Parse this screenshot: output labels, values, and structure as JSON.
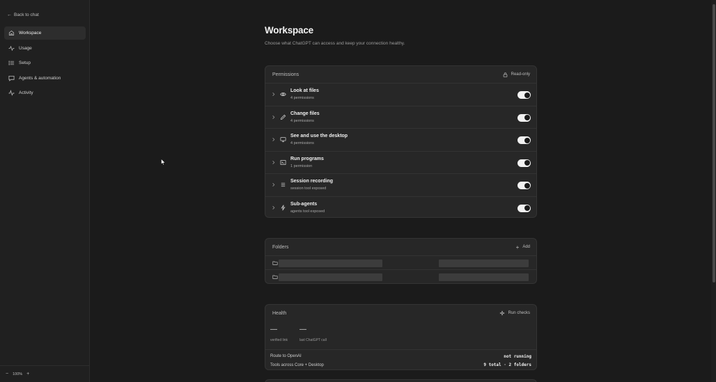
{
  "sidebar": {
    "back_label": "Back to chat",
    "items": [
      {
        "label": "Workspace",
        "icon": "home-icon",
        "active": true
      },
      {
        "label": "Usage",
        "icon": "activity-icon"
      },
      {
        "label": "Setup",
        "icon": "list-icon"
      },
      {
        "label": "Agents & automation",
        "icon": "message-icon"
      },
      {
        "label": "Activity",
        "icon": "pulse-icon"
      }
    ],
    "zoom": {
      "minus": "−",
      "level": "100%",
      "plus": "+"
    }
  },
  "page": {
    "title": "Workspace",
    "subtitle": "Choose what ChatGPT can access and keep your connection healthy."
  },
  "permissions": {
    "title": "Permissions",
    "status": "Read-only",
    "rows": [
      {
        "title": "Look at files",
        "subtitle": "4 permissions",
        "icon": "eye-icon",
        "enabled": true
      },
      {
        "title": "Change files",
        "subtitle": "4 permissions",
        "icon": "pencil-icon",
        "enabled": true
      },
      {
        "title": "See and use the desktop",
        "subtitle": "4 permissions",
        "icon": "monitor-icon",
        "enabled": true
      },
      {
        "title": "Run programs",
        "subtitle": "1 permission",
        "icon": "terminal-icon",
        "enabled": true
      },
      {
        "title": "Session recording",
        "subtitle": "session tool exposed",
        "icon": "lines-icon",
        "enabled": true
      },
      {
        "title": "Sub-agents",
        "subtitle": "agents tool exposed",
        "icon": "bolt-icon",
        "enabled": true
      }
    ]
  },
  "folders": {
    "title": "Folders",
    "add_label": "Add"
  },
  "health": {
    "title": "Health",
    "run_label": "Run checks",
    "stats": [
      {
        "value": "—",
        "label": "verified link"
      },
      {
        "value": "—",
        "label": "last ChatGPT call"
      }
    ],
    "rows": [
      {
        "label": "Route to OpenAI",
        "value": "not running"
      },
      {
        "label": "Tools across Core + Desktop",
        "value": "9 total · 2 folders"
      }
    ]
  }
}
